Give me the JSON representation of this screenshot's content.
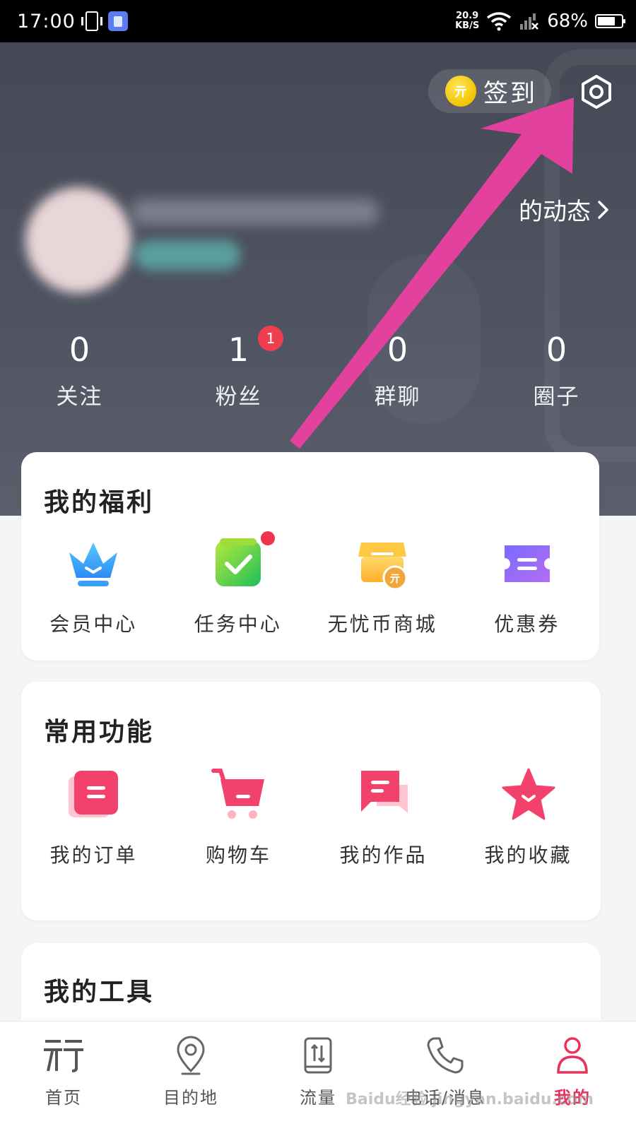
{
  "status_bar": {
    "time": "17:00",
    "net_speed_value": "20.9",
    "net_speed_unit": "KB/S",
    "battery_percent": "68%",
    "battery_level": 0.68
  },
  "header": {
    "sign_in_label": "签到",
    "coin_glyph": "亓",
    "dynamic_link_label": "的动态",
    "stats": [
      {
        "value": "0",
        "label": "关注"
      },
      {
        "value": "1",
        "label": "粉丝",
        "badge": "1"
      },
      {
        "value": "0",
        "label": "群聊"
      },
      {
        "value": "0",
        "label": "圈子"
      }
    ]
  },
  "benefits": {
    "title": "我的福利",
    "items": [
      {
        "label": "会员中心",
        "icon": "crown-icon"
      },
      {
        "label": "任务中心",
        "icon": "task-check-icon"
      },
      {
        "label": "无忧币商城",
        "icon": "coin-store-icon"
      },
      {
        "label": "优惠券",
        "icon": "coupon-icon"
      }
    ]
  },
  "common": {
    "title": "常用功能",
    "items": [
      {
        "label": "我的订单",
        "icon": "order-icon"
      },
      {
        "label": "购物车",
        "icon": "shopping-cart-icon"
      },
      {
        "label": "我的作品",
        "icon": "works-icon"
      },
      {
        "label": "我的收藏",
        "icon": "star-icon"
      }
    ]
  },
  "tools": {
    "title": "我的工具"
  },
  "bottom_nav": [
    {
      "label": "首页",
      "icon": "home-logo-icon"
    },
    {
      "label": "目的地",
      "icon": "location-pin-icon"
    },
    {
      "label": "流量",
      "icon": "data-sim-icon"
    },
    {
      "label": "电话/消息",
      "icon": "phone-icon"
    },
    {
      "label": "我的",
      "icon": "profile-icon",
      "active": true
    }
  ],
  "watermark": "Baidu经验 jingyan.baidu.com",
  "colors": {
    "accent_pink": "#e8325c",
    "header_bg": "#4b4f5c",
    "badge_red": "#ef3e4f",
    "annotation_arrow": "#e2429d"
  }
}
